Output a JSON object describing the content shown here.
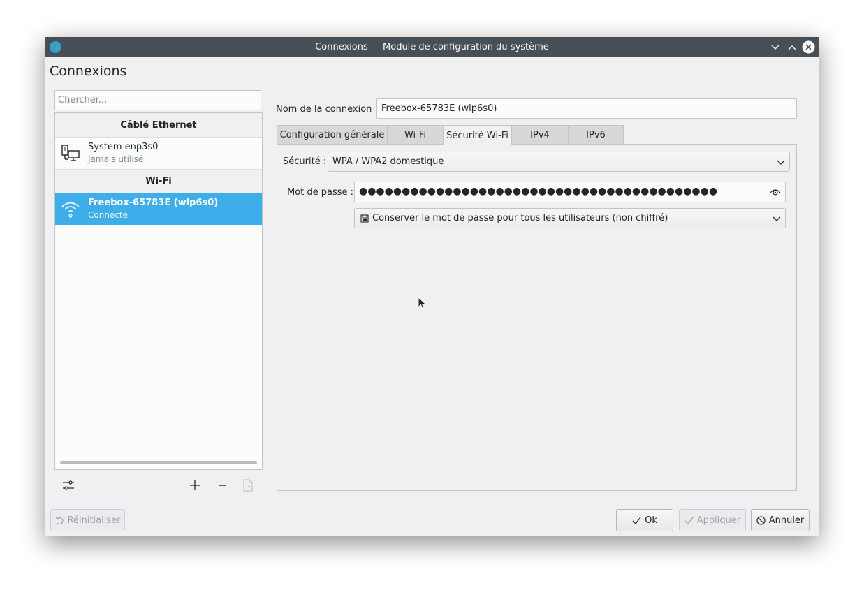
{
  "window": {
    "title": "Connexions — Module de configuration du système",
    "heading": "Connexions",
    "controls": [
      "minimize-icon",
      "maximize-icon",
      "close-icon"
    ]
  },
  "sidebar": {
    "search_placeholder": "Chercher...",
    "sections": [
      {
        "header": "Câblé Ethernet",
        "items": [
          {
            "name": "System enp3s0",
            "status": "Jamais utilisé",
            "icon": "network-wired-icon",
            "selected": false
          }
        ]
      },
      {
        "header": "Wi-Fi",
        "items": [
          {
            "name": "Freebox-65783E (wlp6s0)",
            "status": "Connecté",
            "icon": "wifi-icon",
            "selected": true
          }
        ]
      }
    ],
    "toolbar": [
      "configure-icon",
      "add-icon",
      "remove-icon",
      "export-icon"
    ]
  },
  "details": {
    "connection_name_label": "Nom de la connexion :",
    "connection_name_value": "Freebox-65783E (wlp6s0)",
    "tabs": [
      {
        "label": "Configuration générale",
        "active": false
      },
      {
        "label": "Wi-Fi",
        "active": false
      },
      {
        "label": "Sécurité Wi-Fi",
        "active": true
      },
      {
        "label": "IPv4",
        "active": false
      },
      {
        "label": "IPv6",
        "active": false
      }
    ],
    "security_label": "Sécurité :",
    "security_value": "WPA / WPA2 domestique",
    "password_label": "Mot de passe :",
    "password_masked": "●●●●●●●●●●●●●●●●●●●●●●●●●●●●●●●●●●●●●●●●●●",
    "password_storage_value": "Conserver le mot de passe pour tous les utilisateurs (non chiffré)"
  },
  "footer": {
    "reset_label": "Réinitialiser",
    "ok_label": "Ok",
    "apply_label": "Appliquer",
    "cancel_label": "Annuler"
  },
  "colors": {
    "titlebar": "#475057",
    "selection": "#3daee9",
    "window_bg": "#eff0f1"
  }
}
